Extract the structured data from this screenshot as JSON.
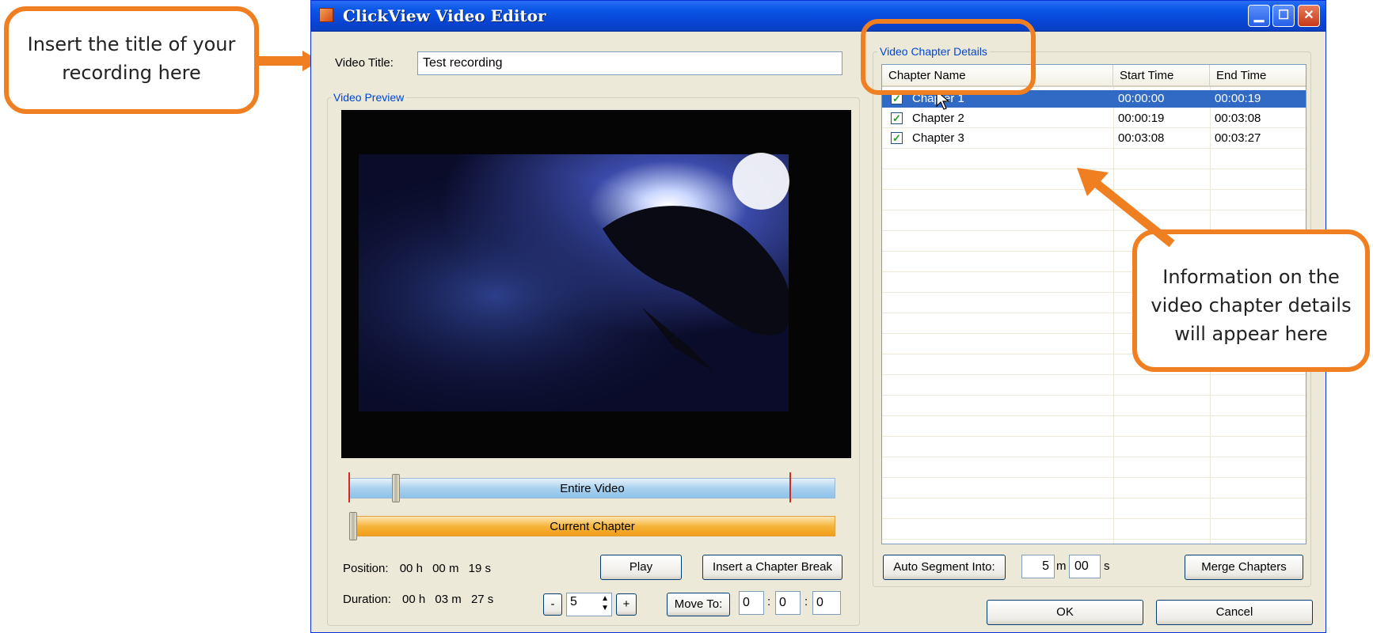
{
  "window": {
    "title": "ClickView Video Editor",
    "controls": {
      "minimize": "minimize-icon",
      "maximize": "maximize-icon",
      "close": "close-icon"
    }
  },
  "video_title": {
    "label": "Video Title:",
    "value": "Test recording"
  },
  "video_preview": {
    "label": "Video Preview"
  },
  "sliders": {
    "entire_video_label": "Entire Video",
    "current_chapter_label": "Current Chapter"
  },
  "position": {
    "label": "Position:",
    "h": "00 h",
    "m": "00 m",
    "s": "19 s"
  },
  "duration": {
    "label": "Duration:",
    "h": "00 h",
    "m": "03 m",
    "s": "27 s"
  },
  "buttons": {
    "play": "Play",
    "insert_chapter_break": "Insert a Chapter Break",
    "minus": "-",
    "plus": "+",
    "move_to": "Move To:",
    "auto_segment": "Auto Segment Into:",
    "merge_chapters": "Merge Chapters",
    "ok": "OK",
    "cancel": "Cancel"
  },
  "step_value": "5",
  "move_to_fields": [
    "0",
    "0",
    "0"
  ],
  "auto_segment_fields": {
    "minutes": "5",
    "m_unit": "m",
    "seconds": "00",
    "s_unit": "s"
  },
  "chapter_details": {
    "label": "Video Chapter Details",
    "columns": [
      "Chapter Name",
      "Start Time",
      "End Time"
    ],
    "rows": [
      {
        "name": "Chapter 1",
        "start": "00:00:00",
        "end": "00:00:19",
        "checked": true,
        "selected": true
      },
      {
        "name": "Chapter 2",
        "start": "00:00:19",
        "end": "00:03:08",
        "checked": true,
        "selected": false
      },
      {
        "name": "Chapter 3",
        "start": "00:03:08",
        "end": "00:03:27",
        "checked": true,
        "selected": false
      }
    ]
  },
  "callouts": {
    "title_hint": "Insert the title of your recording here",
    "details_hint": "Information on the video chapter details will appear here"
  },
  "colors": {
    "accent_orange": "#f07f21",
    "selection_blue": "#316ac5",
    "groupbox_label": "#0046d5"
  }
}
